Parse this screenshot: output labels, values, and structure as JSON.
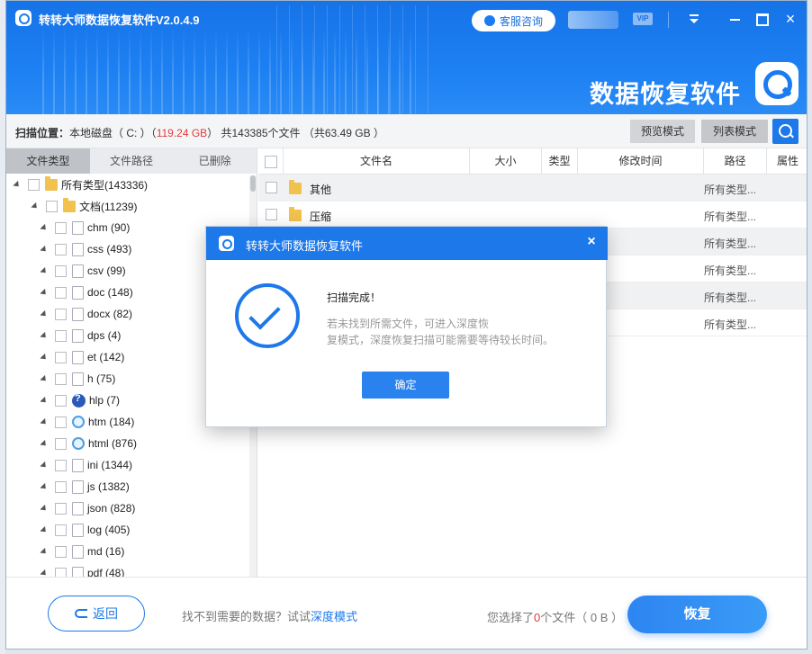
{
  "app": {
    "title": "转转大师数据恢复软件V2.0.4.9",
    "service_label": "客服咨询",
    "vip_label": "VIP",
    "brand_text": "数据恢复软件",
    "close_glyph": "×"
  },
  "scan_info": {
    "prefix": "扫描位置：",
    "location": "本地磁盘（ C: ）（",
    "size": "119.24 GB",
    "suffix": "）  共143385个文件 （共63.49 GB ）"
  },
  "toolbar": {
    "preview_mode": "预览模式",
    "list_mode": "列表模式"
  },
  "left_tabs": [
    "文件类型",
    "文件路径",
    "已删除"
  ],
  "tree": [
    {
      "label": "所有类型(143336)",
      "icon": "folder-icon",
      "indent": 0
    },
    {
      "label": "文档(11239)",
      "icon": "folder-icon",
      "indent": 1
    },
    {
      "label": "chm (90)",
      "icon": "chm-file-icon",
      "indent": 2
    },
    {
      "label": "css (493)",
      "icon": "css-file-icon",
      "indent": 2
    },
    {
      "label": "csv (99)",
      "icon": "csv-file-icon",
      "indent": 2
    },
    {
      "label": "doc (148)",
      "icon": "doc-file-icon",
      "indent": 2
    },
    {
      "label": "docx (82)",
      "icon": "docx-file-icon",
      "indent": 2
    },
    {
      "label": "dps (4)",
      "icon": "dps-file-icon",
      "indent": 2
    },
    {
      "label": "et (142)",
      "icon": "et-file-icon",
      "indent": 2
    },
    {
      "label": "h (75)",
      "icon": "h-file-icon",
      "indent": 2
    },
    {
      "label": "hlp (7)",
      "icon": "help-file-icon",
      "indent": 2
    },
    {
      "label": "htm (184)",
      "icon": "htm-file-icon",
      "indent": 2
    },
    {
      "label": "html (876)",
      "icon": "html-file-icon",
      "indent": 2
    },
    {
      "label": "ini (1344)",
      "icon": "ini-file-icon",
      "indent": 2
    },
    {
      "label": "js (1382)",
      "icon": "js-file-icon",
      "indent": 2
    },
    {
      "label": "json (828)",
      "icon": "json-file-icon",
      "indent": 2
    },
    {
      "label": "log (405)",
      "icon": "log-file-icon",
      "indent": 2
    },
    {
      "label": "md (16)",
      "icon": "md-file-icon",
      "indent": 2
    },
    {
      "label": "pdf (48)",
      "icon": "pdf-file-icon",
      "indent": 2
    }
  ],
  "table": {
    "headers": [
      "文件名",
      "大小",
      "类型",
      "修改时间",
      "路径",
      "属性"
    ],
    "rows": [
      {
        "name": "其他",
        "path": "所有类型..."
      },
      {
        "name": "压缩",
        "path": "所有类型..."
      },
      {
        "name": "",
        "path": "所有类型..."
      },
      {
        "name": "",
        "path": "所有类型..."
      },
      {
        "name": "",
        "path": "所有类型..."
      },
      {
        "name": "",
        "path": "所有类型..."
      }
    ]
  },
  "footer": {
    "back_label": "返回",
    "hint_prefix": "找不到需要的数据？试试",
    "hint_link": "深度模式",
    "selected_prefix": "您选择了",
    "selected_count": "0",
    "selected_suffix": "个文件（ 0 B ）",
    "recover_label": "恢复"
  },
  "modal": {
    "title": "转转大师数据恢复软件",
    "close_glyph": "×",
    "heading": "扫描完成！",
    "desc_line1": "若未找到所需文件，可进入深度恢",
    "desc_line2": "复模式，深度恢复扫描可能需要等待较长时间。",
    "ok_label": "确定"
  }
}
